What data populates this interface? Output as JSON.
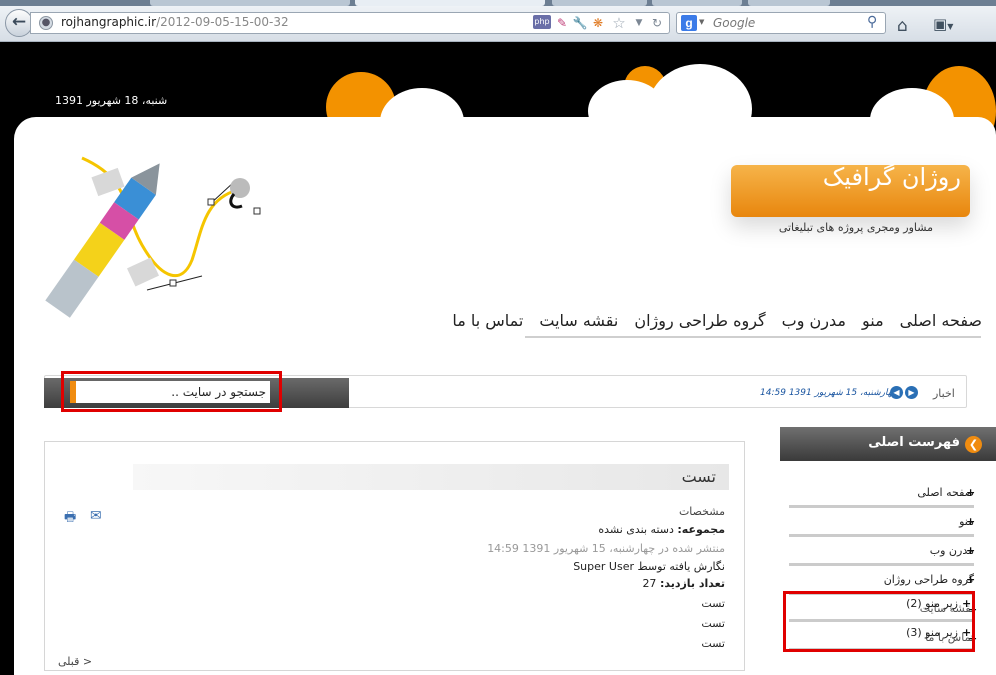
{
  "browser": {
    "url_domain": "rojhangraphic.ir",
    "url_path": "/2012-09-05-15-00-32",
    "search_placeholder": "Google",
    "icons": [
      "back-icon",
      "globe-icon",
      "php-icon",
      "pen-icon",
      "wrench-icon",
      "joomla-icon",
      "star-icon",
      "dropdown-icon",
      "refresh-icon",
      "google-icon",
      "search-icon",
      "home-icon",
      "bookmarks-icon"
    ]
  },
  "site": {
    "date": "شنبه، 18 شهریور 1391",
    "logo_title": "روژان گرافیک",
    "logo_subtitle": "مشاور ومجری پروژه های تبلیغاتی",
    "nav": [
      "صفحه اصلی",
      "منو",
      "مدرن وب",
      "گروه طراحی روژان",
      "نقشه سایت",
      "تماس با ما"
    ],
    "news_label": "اخبار",
    "news_item": "- چهارشنبه، 15 شهریور 1391 14:59",
    "search_value": "جستجو در سایت ..",
    "colors": {
      "accent_orange": "#f08c10",
      "highlight_red": "#e00000",
      "news_blue": "#1a55a0"
    }
  },
  "article": {
    "title": "تست",
    "details_label": "مشخصات",
    "category_label": "مجموعه:",
    "category_value": "دسته بندی نشده",
    "published": "منتشر شده در چهارشنبه، 15 شهریور 1391 14:59",
    "written_by_label": "نگارش یافته توسط",
    "written_by_value": "Super User",
    "hits_label": "تعداد بازدید:",
    "hits_value": "27",
    "body_lines": [
      "تست",
      "تست",
      "تست"
    ],
    "prev_link": "< قبلی"
  },
  "menu": {
    "title": "فهرست اصلی",
    "items": [
      "صفحه اصلی",
      "منو",
      "مدرن وب",
      "گروه طراحی روژان"
    ],
    "overlap_items": [
      {
        "back": "نقشه سایت",
        "front": "زیر منو (2)"
      },
      {
        "back": "تماس با ما",
        "front": "زیر منو (3)"
      }
    ]
  }
}
